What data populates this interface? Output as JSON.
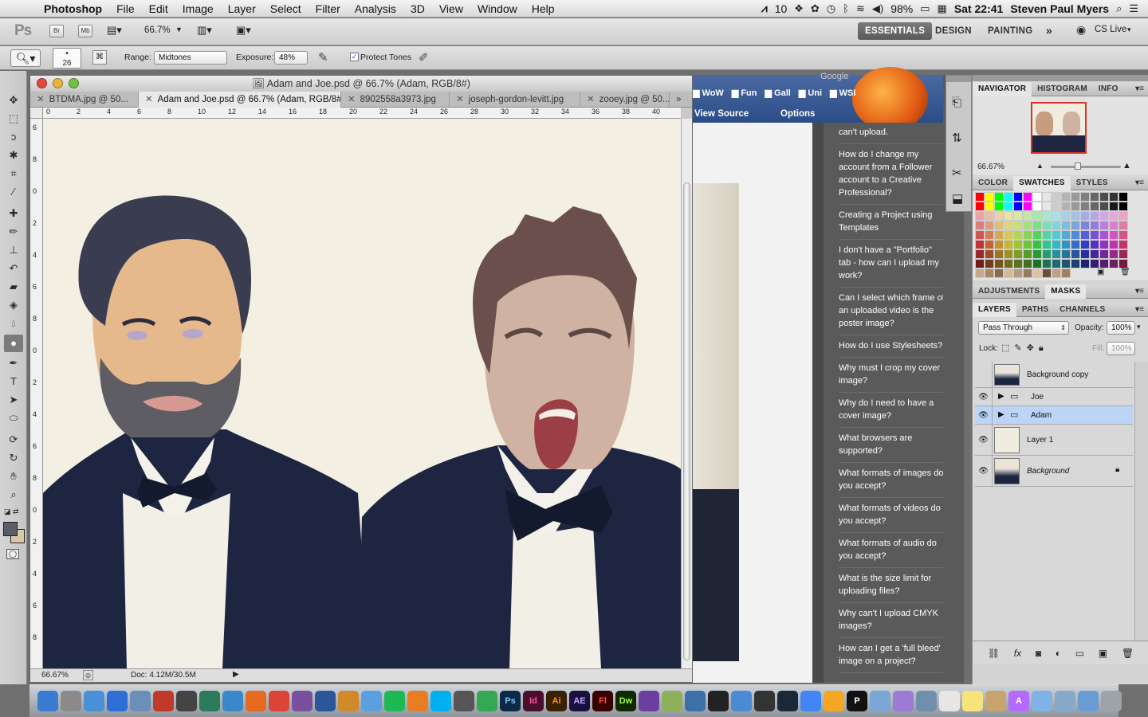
{
  "menubar": {
    "app_name": "Photoshop",
    "menus": [
      "File",
      "Edit",
      "Image",
      "Layer",
      "Select",
      "Filter",
      "Analysis",
      "3D",
      "View",
      "Window",
      "Help"
    ],
    "status_counter": "10",
    "battery": "98%",
    "clock": "Sat 22:41",
    "user": "Steven Paul Myers"
  },
  "appbar": {
    "logo": "Ps",
    "bridge": "Br",
    "minibridge": "Mb",
    "zoom": "66.7%",
    "workspaces": [
      "ESSENTIALS",
      "DESIGN",
      "PAINTING"
    ],
    "more": "»",
    "cslive": "CS Live"
  },
  "options": {
    "brush_size": "26",
    "range_label": "Range:",
    "range_value": "Midtones",
    "exposure_label": "Exposure:",
    "exposure_value": "48%",
    "protect_tones": "Protect Tones"
  },
  "document": {
    "title": "Adam and Joe.psd @ 66.7% (Adam, RGB/8#)",
    "tabs": [
      "BTDMA.jpg @ 50...",
      "Adam and Joe.psd @ 66.7% (Adam, RGB/8#)",
      "8902558a3973.jpg",
      "joseph-gordon-levitt.jpg",
      "zooey.jpg @ 50..."
    ],
    "ruler_h": [
      "0",
      "2",
      "4",
      "6",
      "8",
      "10",
      "12",
      "14",
      "16",
      "18",
      "20",
      "22",
      "24",
      "26",
      "28",
      "30",
      "32",
      "34",
      "36",
      "38",
      "40"
    ],
    "ruler_v": [
      "6",
      "8",
      "0",
      "2",
      "4",
      "6",
      "8",
      "0",
      "2",
      "4",
      "6",
      "8",
      "0",
      "2",
      "4",
      "6",
      "8"
    ],
    "zoom": "66.67%",
    "doc_size": "Doc: 4.12M/30.5M"
  },
  "browser": {
    "bookmarks": [
      "WoW",
      "Fun",
      "Gall",
      "Uni",
      "WSI"
    ],
    "view_source": "View Source",
    "options": "Options",
    "search_hint": "Google",
    "faq": [
      "can't upload.",
      "How do I change my account from a Follower account to a Creative Professional?",
      "Creating a Project using Templates",
      "I don't have a \"Portfolio\" tab - how can I upload my work?",
      "Can I select which frame of an uploaded video is the poster image?",
      "How do I use Stylesheets?",
      "Why must I crop my cover image?",
      "Why do I need to have a cover image?",
      "What browsers are supported?",
      "What formats of images do you accept?",
      "What formats of videos do you accept?",
      "What formats of audio do you accept?",
      "What is the size limit for uploading files?",
      "Why can't I upload CMYK images?",
      "How can I get a 'full bleed' image on a project?"
    ]
  },
  "panels": {
    "navigator_tabs": [
      "NAVIGATOR",
      "HISTOGRAM",
      "INFO"
    ],
    "nav_zoom": "66.67%",
    "color_tabs": [
      "COLOR",
      "SWATCHES",
      "STYLES"
    ],
    "adj_tabs": [
      "ADJUSTMENTS",
      "MASKS"
    ],
    "layer_tabs": [
      "LAYERS",
      "PATHS",
      "CHANNELS"
    ],
    "blend_mode": "Pass Through",
    "opacity_label": "Opacity:",
    "opacity": "100%",
    "lock_label": "Lock:",
    "fill_label": "Fill:",
    "fill": "100%",
    "layers": [
      {
        "name": "Background copy",
        "visible": false
      },
      {
        "name": "Joe",
        "visible": true
      },
      {
        "name": "Adam",
        "visible": true
      },
      {
        "name": "Layer 1",
        "visible": true
      },
      {
        "name": "Background",
        "visible": true
      }
    ]
  },
  "dock": {
    "apps": [
      "Finder",
      "Launchpad",
      "Preview",
      "App Store",
      "Mail",
      "Photo Booth",
      "Dashboard",
      "Time Machine",
      "Safari",
      "Firefox",
      "Chrome",
      "Camino",
      "Word",
      "Transmit",
      "iTunes",
      "Spotify",
      "Kindle",
      "Skype",
      "Trash",
      "Google Drive",
      "Ps",
      "Id",
      "Ai",
      "AE",
      "Fl",
      "Dw",
      "Sp",
      "Adium",
      "Mission",
      "Unity",
      "Cloud",
      "Dash",
      "Steam",
      "Google",
      "Pages",
      "P",
      "Folders",
      "Kaleido",
      "Tools",
      "Notes",
      "Stickies",
      "Home",
      "A",
      "Apps",
      "Docs",
      "Downloads",
      "Trash"
    ]
  },
  "colors": {
    "accent_selected_layer": "#bcd4f6",
    "suit": "#1d2541",
    "canvas_bg": "#f3efe3"
  }
}
